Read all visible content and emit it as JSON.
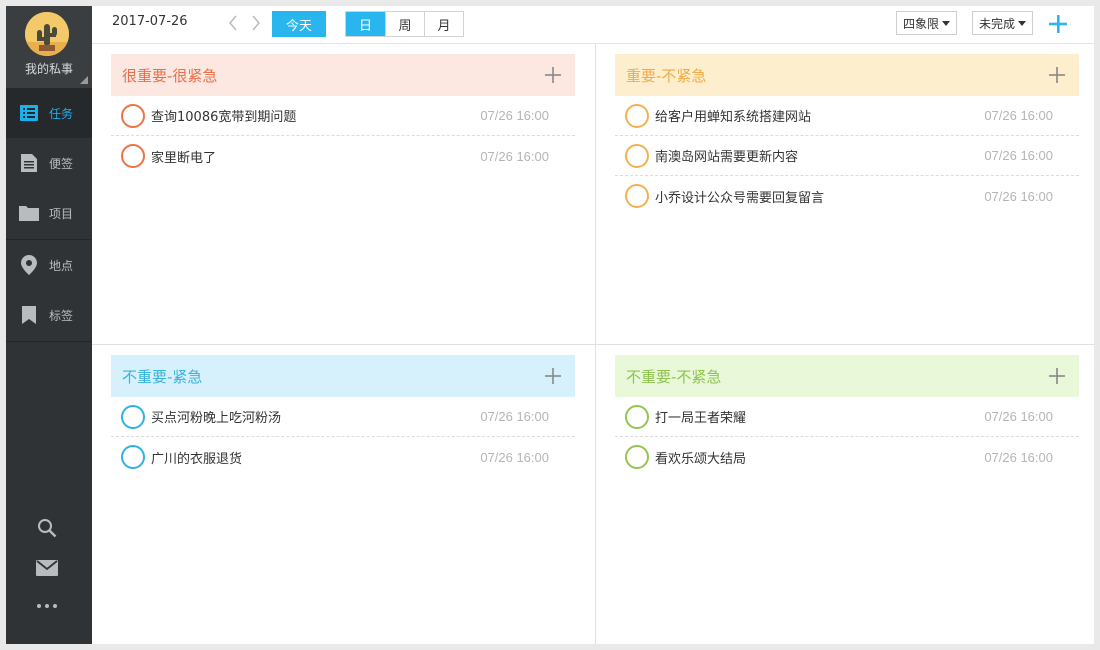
{
  "colors": {
    "accent": "#29b6ef",
    "sidebar_bg": "#2f3335",
    "q1_bg": "#fde8e1",
    "q1_text": "#e8704a",
    "q1_circle": "#ee7242",
    "q2_bg": "#fdeecd",
    "q2_text": "#f0ab4a",
    "q2_circle": "#f3b250",
    "q3_bg": "#d6f1fb",
    "q3_text": "#3ab3dd",
    "q3_circle": "#2eb2e6",
    "q4_bg": "#e9f8d9",
    "q4_text": "#8fc34f",
    "q4_circle": "#94c54f"
  },
  "profile": {
    "name": "我的私事",
    "avatar_icon": "cactus-avatar-icon"
  },
  "nav": [
    {
      "label": "任务",
      "icon": "task-list-icon",
      "active": true
    },
    {
      "label": "便签",
      "icon": "note-icon",
      "active": false
    },
    {
      "label": "项目",
      "icon": "folder-icon",
      "active": false
    },
    {
      "label": "地点",
      "icon": "location-pin-icon",
      "active": false
    },
    {
      "label": "标签",
      "icon": "bookmark-icon",
      "active": false
    }
  ],
  "sidebar_bottom": [
    "search-icon",
    "mail-icon",
    "more-icon"
  ],
  "topbar": {
    "date": "2017-07-26",
    "today": "今天",
    "views": [
      "日",
      "周",
      "月"
    ],
    "selected_view": "日",
    "layout_select": "四象限",
    "status_select": "未完成"
  },
  "quadrants": [
    {
      "title": "很重要-很紧急",
      "tasks": [
        {
          "title": "查询10086宽带到期问题",
          "time": "07/26 16:00"
        },
        {
          "title": "家里断电了",
          "time": "07/26 16:00"
        }
      ]
    },
    {
      "title": "重要-不紧急",
      "tasks": [
        {
          "title": "给客户用蝉知系统搭建网站",
          "time": "07/26 16:00"
        },
        {
          "title": "南澳岛网站需要更新内容",
          "time": "07/26 16:00"
        },
        {
          "title": "小乔设计公众号需要回复留言",
          "time": "07/26 16:00"
        }
      ]
    },
    {
      "title": "不重要-紧急",
      "tasks": [
        {
          "title": "买点河粉晚上吃河粉汤",
          "time": "07/26 16:00"
        },
        {
          "title": "广川的衣服退货",
          "time": "07/26 16:00"
        }
      ]
    },
    {
      "title": "不重要-不紧急",
      "tasks": [
        {
          "title": "打一局王者荣耀",
          "time": "07/26 16:00"
        },
        {
          "title": "看欢乐颂大结局",
          "time": "07/26 16:00"
        }
      ]
    }
  ]
}
